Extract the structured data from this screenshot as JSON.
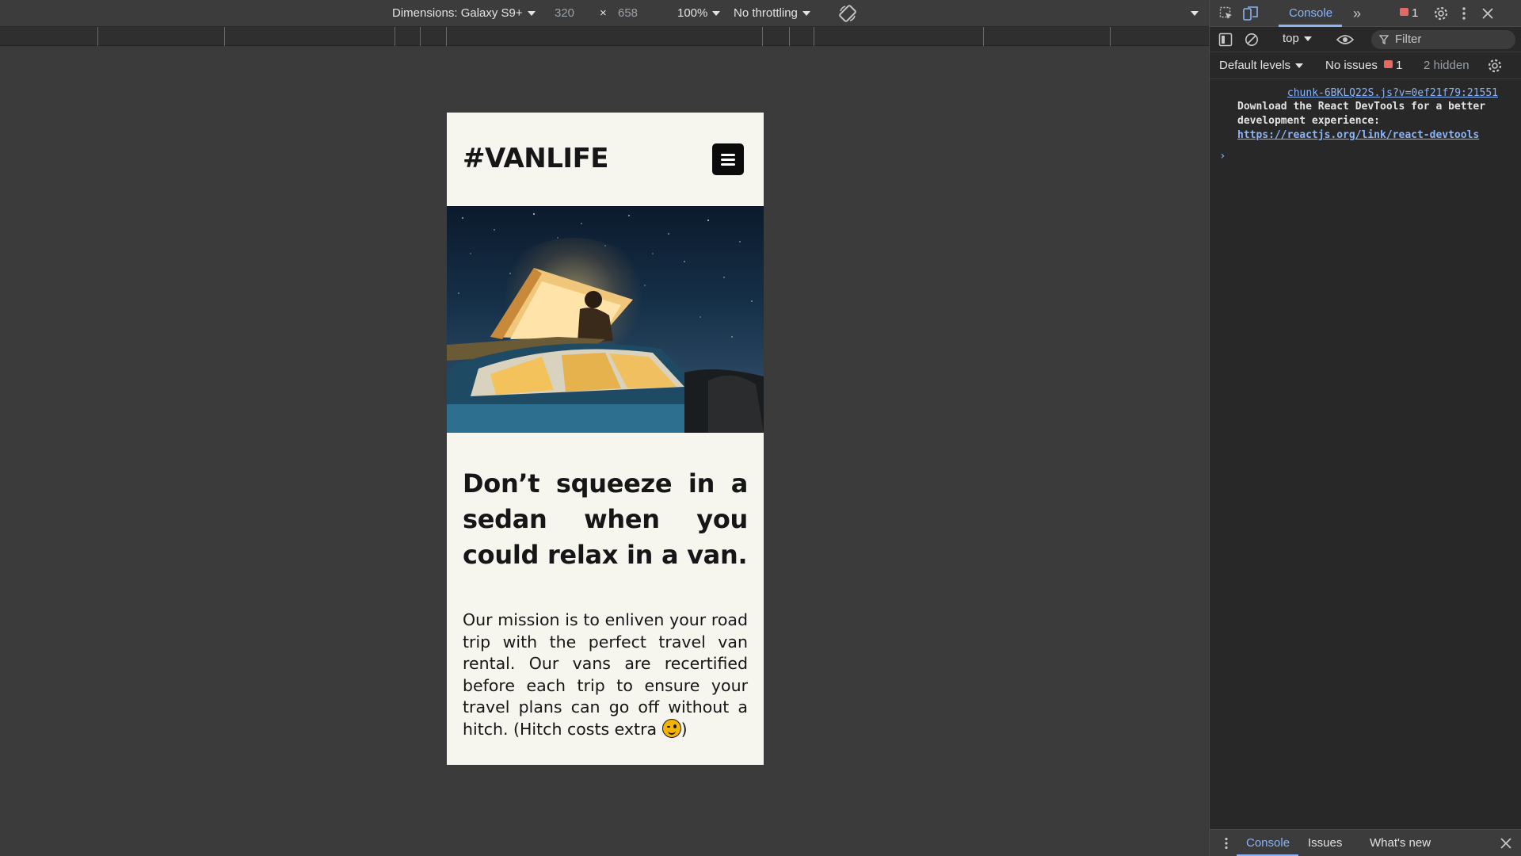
{
  "device_toolbar": {
    "dimensions_label": "Dimensions: Galaxy S9+",
    "width": "320",
    "times": "×",
    "height": "658",
    "zoom": "100%",
    "throttling": "No throttling"
  },
  "page": {
    "logo": "#VANLIFE",
    "headline": "Don’t squeeze in a sedan when you could relax in a van.",
    "mission_text": "Our mission is to enliven your road trip with the perfect travel van rental. Our vans are recertified before each trip to ensure your travel plans can go off without a hitch. (Hitch costs extra ",
    "mission_close": ")"
  },
  "devtools": {
    "tab_console": "Console",
    "more_tabs": "»",
    "error_count": "1",
    "context": "top",
    "filter_placeholder": "Filter",
    "default_levels": "Default levels",
    "no_issues": "No issues",
    "issues_count": "1",
    "hidden": "2 hidden",
    "console": {
      "source": "chunk-6BKLQ22S.js?v=0ef21f79:21551",
      "message": "Download the React DevTools for a better development experience: ",
      "link": "https://reactjs.org/link/react-devtools",
      "prompt": "›"
    },
    "drawer": {
      "tab_console": "Console",
      "tab_issues": "Issues",
      "tab_whats_new": "What's new"
    }
  },
  "colors": {
    "page_bg": "#f6f5ee",
    "devtools_accent": "#8ab4f8",
    "error_red": "#e46962"
  }
}
